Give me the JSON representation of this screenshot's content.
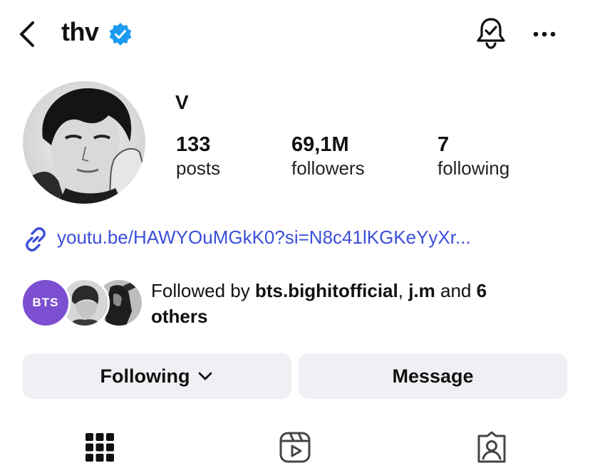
{
  "header": {
    "username": "thv",
    "icons": {
      "back": "chevron-left-icon",
      "verified": "verified-badge-icon",
      "notifications": "bell-check-icon",
      "more": "more-horizontal-icon"
    }
  },
  "profile": {
    "display_name": "V",
    "stats": [
      {
        "value": "133",
        "label": "posts"
      },
      {
        "value": "69,1M",
        "label": "followers"
      },
      {
        "value": "7",
        "label": "following"
      }
    ],
    "link": "youtu.be/HAWYOuMGkK0?si=N8c41lKGKeYyXr..."
  },
  "followed_by": {
    "prefix": "Followed by ",
    "user1": "bts.bighitofficial",
    "sep": ", ",
    "user2": "j.m",
    "and": " and ",
    "count": "6",
    "suffix": "others",
    "badge_text": "BTS"
  },
  "buttons": {
    "following": "Following",
    "message": "Message"
  },
  "tabs": [
    "grid-icon",
    "reels-icon",
    "tagged-icon"
  ],
  "colors": {
    "accent_link": "#3b4fd8",
    "verified": "#1d9bf0",
    "bts_badge": "#7c4fd0",
    "button_bg": "#eff0f3"
  }
}
